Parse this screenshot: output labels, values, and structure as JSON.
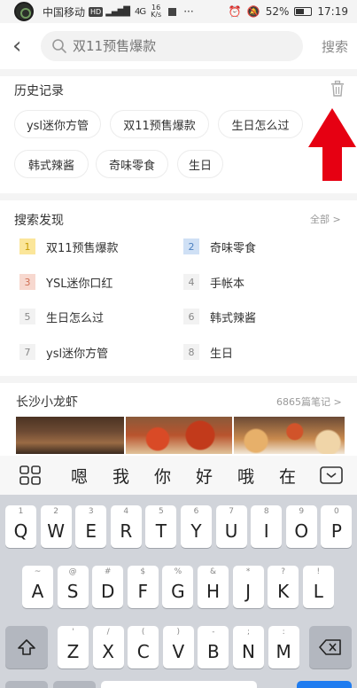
{
  "status_bar": {
    "carrier": "中国移动",
    "hd": "HD",
    "network": "4G",
    "speed_value": "16",
    "speed_unit": "K/s",
    "battery": "52%",
    "time": "17:19"
  },
  "header": {
    "search_placeholder": "双11预售爆款",
    "search_button": "搜索"
  },
  "history": {
    "title": "历史记录",
    "items": [
      "ysl迷你方管",
      "双11预售爆款",
      "生日怎么过",
      "韩式辣酱",
      "奇味零食",
      "生日"
    ]
  },
  "discovery": {
    "title": "搜索发现",
    "all_link": "全部 >",
    "items": [
      {
        "rank": "1",
        "label": "双11预售爆款"
      },
      {
        "rank": "2",
        "label": "奇味零食"
      },
      {
        "rank": "3",
        "label": "YSL迷你口红"
      },
      {
        "rank": "4",
        "label": "手帐本"
      },
      {
        "rank": "5",
        "label": "生日怎么过"
      },
      {
        "rank": "6",
        "label": "韩式辣酱"
      },
      {
        "rank": "7",
        "label": "ysl迷你方管"
      },
      {
        "rank": "8",
        "label": "生日"
      }
    ]
  },
  "note": {
    "title": "长沙小龙虾",
    "count": "6865篇笔记 >"
  },
  "keyboard": {
    "candidates": [
      "嗯",
      "我",
      "你",
      "好",
      "哦",
      "在"
    ],
    "row1": [
      [
        "1",
        "Q"
      ],
      [
        "2",
        "W"
      ],
      [
        "3",
        "E"
      ],
      [
        "4",
        "R"
      ],
      [
        "5",
        "T"
      ],
      [
        "6",
        "Y"
      ],
      [
        "7",
        "U"
      ],
      [
        "8",
        "I"
      ],
      [
        "9",
        "O"
      ],
      [
        "0",
        "P"
      ]
    ],
    "row2": [
      [
        "~",
        "A"
      ],
      [
        "@",
        "S"
      ],
      [
        "#",
        "D"
      ],
      [
        "$",
        "F"
      ],
      [
        "%",
        "G"
      ],
      [
        "&",
        "H"
      ],
      [
        "*",
        "J"
      ],
      [
        "?",
        "K"
      ],
      [
        "!",
        "L"
      ]
    ],
    "row3": [
      [
        "'",
        "Z"
      ],
      [
        "/",
        "X"
      ],
      [
        "(",
        "C"
      ],
      [
        ")",
        "V"
      ],
      [
        "-",
        "B"
      ],
      [
        ";",
        "N"
      ],
      [
        ":",
        "M"
      ]
    ]
  },
  "colors": {
    "annotation_arrow": "#e60012",
    "rank1": "#fbe69a",
    "rank2": "#cfe0f5",
    "rank3": "#f7d8cf"
  }
}
